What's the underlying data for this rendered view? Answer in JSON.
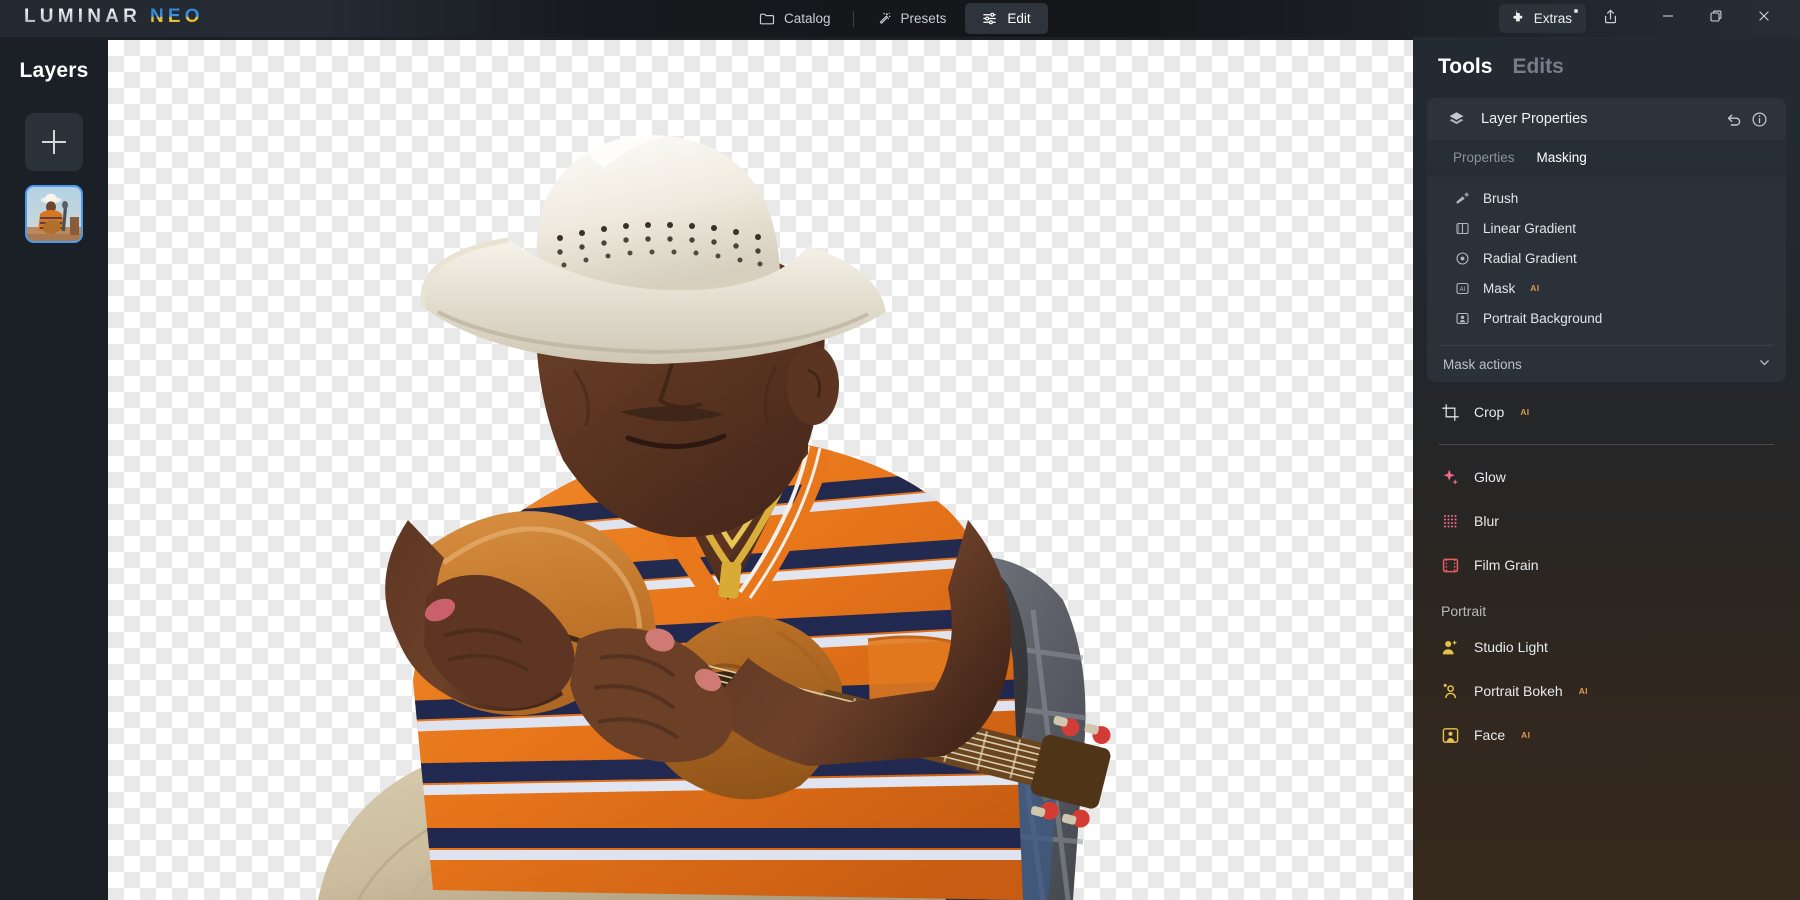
{
  "app": {
    "brand_primary": "LUMINAR",
    "brand_secondary": "NEO",
    "accent_blue": "#2b7fd4",
    "accent_yellow": "#e8c73a",
    "selection_blue": "#4a9bf0",
    "ai_badge_color": "#d89a4a"
  },
  "topbar": {
    "nav": [
      {
        "label": "Catalog",
        "icon": "folder-icon",
        "active": false
      },
      {
        "label": "Presets",
        "icon": "sparkle-wand-icon",
        "active": false
      },
      {
        "label": "Edit",
        "icon": "sliders-icon",
        "active": true
      }
    ],
    "extras": {
      "label": "Extras",
      "icon": "puzzle-piece-icon",
      "badge": true
    },
    "window_controls": [
      {
        "name": "share-button",
        "icon": "share-icon"
      },
      {
        "name": "minimize-button",
        "icon": "minimize-icon"
      },
      {
        "name": "maximize-button",
        "icon": "maximize-icon"
      },
      {
        "name": "close-button",
        "icon": "close-icon"
      }
    ]
  },
  "sidebar": {
    "title": "Layers",
    "add_layer_label": "+",
    "layer_thumbnail_selected": true
  },
  "canvas": {
    "background": "transparent-checkerboard",
    "checker_size_px": 16,
    "subject": "Elderly man in white straw cowboy hat playing an acoustic guitar, wearing an orange polo shirt with navy and white horizontal stripes and a gold chain necklace, khaki trousers, seated with a dark backpack and wicker chair behind"
  },
  "rightpanel": {
    "tabs": [
      {
        "label": "Tools",
        "active": true
      },
      {
        "label": "Edits",
        "active": false
      }
    ],
    "layer_properties": {
      "title": "Layer Properties",
      "icon": "layers-icon",
      "reset_icon": "undo-icon",
      "info_icon": "info-icon",
      "subtabs": [
        {
          "label": "Properties",
          "active": false
        },
        {
          "label": "Masking",
          "active": true
        }
      ],
      "mask_tools": [
        {
          "label": "Brush",
          "icon": "brush-icon",
          "ai": false
        },
        {
          "label": "Linear Gradient",
          "icon": "linear-gradient-icon",
          "ai": false
        },
        {
          "label": "Radial Gradient",
          "icon": "radial-gradient-icon",
          "ai": false
        },
        {
          "label": "Mask",
          "icon": "mask-ai-icon",
          "ai": true
        },
        {
          "label": "Portrait Background",
          "icon": "portrait-background-icon",
          "ai": false
        }
      ],
      "mask_actions": {
        "label": "Mask actions",
        "icon": "chevron-down-icon",
        "expanded": false
      }
    },
    "tools": [
      {
        "label": "Crop",
        "icon": "crop-icon",
        "ai": true,
        "color": "#d9dde1"
      }
    ],
    "creative": [
      {
        "label": "Glow",
        "icon": "glow-icon",
        "ai": false,
        "color": "#ef6a86"
      },
      {
        "label": "Blur",
        "icon": "blur-icon",
        "ai": false,
        "color": "#ee6c88"
      },
      {
        "label": "Film Grain",
        "icon": "film-grain-icon",
        "ai": false,
        "color": "#ef5a62"
      }
    ],
    "portrait_section_label": "Portrait",
    "portrait": [
      {
        "label": "Studio Light",
        "icon": "studio-light-icon",
        "ai": false,
        "color": "#e8c14a"
      },
      {
        "label": "Portrait Bokeh",
        "icon": "portrait-bokeh-icon",
        "ai": true,
        "color": "#e8c14a"
      },
      {
        "label": "Face",
        "icon": "face-icon",
        "ai": true,
        "color": "#e8c14a"
      }
    ]
  },
  "ai_badge_text": "AI"
}
